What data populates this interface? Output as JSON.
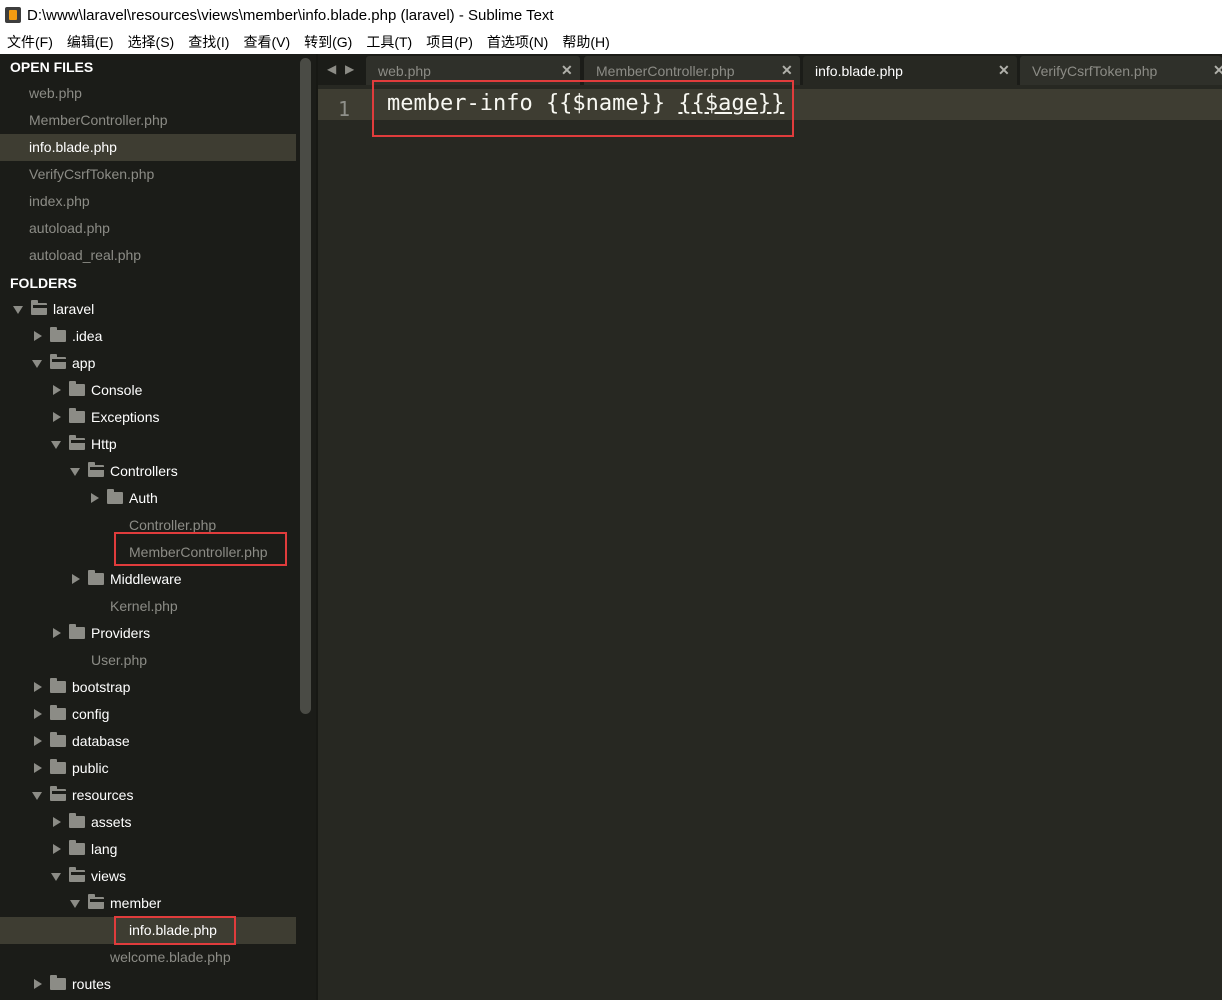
{
  "window": {
    "title": "D:\\www\\laravel\\resources\\views\\member\\info.blade.php (laravel) - Sublime Text"
  },
  "menu": {
    "items": [
      "文件(F)",
      "编辑(E)",
      "选择(S)",
      "查找(I)",
      "查看(V)",
      "转到(G)",
      "工具(T)",
      "项目(P)",
      "首选项(N)",
      "帮助(H)"
    ]
  },
  "sidebar": {
    "open_files_header": "OPEN FILES",
    "open_files": [
      "web.php",
      "MemberController.php",
      "info.blade.php",
      "VerifyCsrfToken.php",
      "index.php",
      "autoload.php",
      "autoload_real.php"
    ],
    "active_open_file": "info.blade.php",
    "folders_header": "FOLDERS",
    "tree": [
      {
        "label": "laravel",
        "kind": "folder",
        "expanded": true
      },
      {
        "label": ".idea",
        "kind": "folder",
        "expanded": false
      },
      {
        "label": "app",
        "kind": "folder",
        "expanded": true
      },
      {
        "label": "Console",
        "kind": "folder",
        "expanded": false
      },
      {
        "label": "Exceptions",
        "kind": "folder",
        "expanded": false
      },
      {
        "label": "Http",
        "kind": "folder",
        "expanded": true
      },
      {
        "label": "Controllers",
        "kind": "folder",
        "expanded": true
      },
      {
        "label": "Auth",
        "kind": "folder",
        "expanded": false
      },
      {
        "label": "Controller.php",
        "kind": "file"
      },
      {
        "label": "MemberController.php",
        "kind": "file",
        "highlighted": true
      },
      {
        "label": "Middleware",
        "kind": "folder",
        "expanded": false
      },
      {
        "label": "Kernel.php",
        "kind": "file"
      },
      {
        "label": "Providers",
        "kind": "folder",
        "expanded": false
      },
      {
        "label": "User.php",
        "kind": "file"
      },
      {
        "label": "bootstrap",
        "kind": "folder",
        "expanded": false
      },
      {
        "label": "config",
        "kind": "folder",
        "expanded": false
      },
      {
        "label": "database",
        "kind": "folder",
        "expanded": false
      },
      {
        "label": "public",
        "kind": "folder",
        "expanded": false
      },
      {
        "label": "resources",
        "kind": "folder",
        "expanded": true
      },
      {
        "label": "assets",
        "kind": "folder",
        "expanded": false
      },
      {
        "label": "lang",
        "kind": "folder",
        "expanded": false
      },
      {
        "label": "views",
        "kind": "folder",
        "expanded": true
      },
      {
        "label": "member",
        "kind": "folder",
        "expanded": true
      },
      {
        "label": "info.blade.php",
        "kind": "file",
        "active": true,
        "highlighted": true
      },
      {
        "label": "welcome.blade.php",
        "kind": "file"
      },
      {
        "label": "routes",
        "kind": "folder",
        "expanded": false
      }
    ]
  },
  "tabs": {
    "nav_left": "◀",
    "nav_right": "▶",
    "items": [
      {
        "label": "web.php",
        "active": false
      },
      {
        "label": "MemberController.php",
        "active": false
      },
      {
        "label": "info.blade.php",
        "active": true
      },
      {
        "label": "VerifyCsrfToken.php",
        "active": false
      }
    ],
    "close_glyph": "✕"
  },
  "editor": {
    "line_number": "1",
    "code_prefix": "member-info {{$name}} ",
    "code_underlined": "{{$age}}"
  },
  "colors": {
    "editor_bg": "#272822",
    "sidebar_bg": "#1b1c18",
    "highlight_box": "#e03c3c"
  }
}
